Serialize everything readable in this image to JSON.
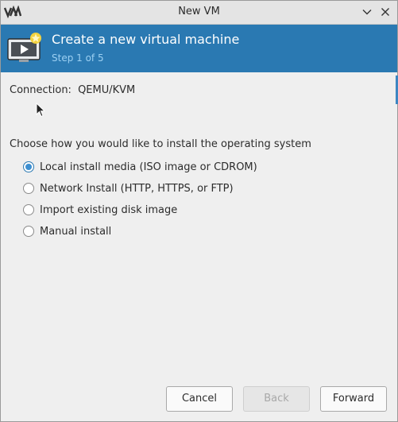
{
  "window": {
    "title": "New VM"
  },
  "banner": {
    "title": "Create a new virtual machine",
    "step": "Step 1 of 5"
  },
  "connection": {
    "label": "Connection:",
    "value": "QEMU/KVM"
  },
  "install": {
    "prompt": "Choose how you would like to install the operating system",
    "options": [
      {
        "label": "Local install media (ISO image or CDROM)",
        "selected": true
      },
      {
        "label": "Network Install (HTTP, HTTPS, or FTP)",
        "selected": false
      },
      {
        "label": "Import existing disk image",
        "selected": false
      },
      {
        "label": "Manual install",
        "selected": false
      }
    ]
  },
  "buttons": {
    "cancel": "Cancel",
    "back": "Back",
    "forward": "Forward"
  },
  "colors": {
    "banner": "#2a79b2",
    "step_text": "#9cd0f2",
    "radio_selected": "#3d8fd1"
  },
  "icons": {
    "app_logo": "virt-manager-logo",
    "minimize": "chevron-down-icon",
    "close": "close-icon",
    "banner": "vm-screen-icon"
  }
}
